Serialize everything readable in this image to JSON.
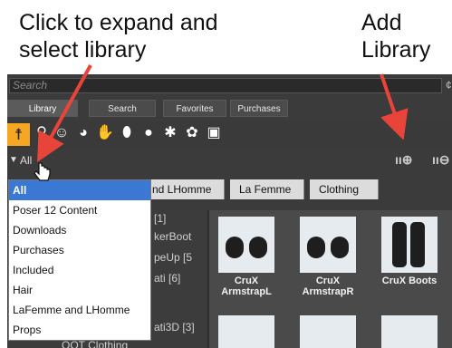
{
  "callouts": {
    "left": [
      "Click to expand and",
      "select library"
    ],
    "right": [
      "Add",
      "Library"
    ]
  },
  "search": {
    "placeholder": "Search"
  },
  "tabs": [
    {
      "label": "Library",
      "active": true
    },
    {
      "label": "Search"
    },
    {
      "label": "Favorites"
    },
    {
      "label": "Purchases"
    }
  ],
  "iconbar": {
    "icons": [
      "figure-icon",
      "pose-icon",
      "face-icon",
      "hair-icon",
      "hand-icon",
      "shoe-icon",
      "light-icon",
      "camera-icon",
      "materials-icon",
      "scene-icon"
    ]
  },
  "library_bar": {
    "selected": "All",
    "add_icon": "add-library-icon",
    "remove_icon": "remove-library-icon"
  },
  "breadcrumb": [
    "nd LHomme",
    "La Femme",
    "Clothing"
  ],
  "dropdown": {
    "items": [
      "All",
      "Poser 12 Content",
      "Downloads",
      "Purchases",
      "Included",
      "Hair",
      "LaFemme and LHomme",
      "Props"
    ],
    "selected_index": 0
  },
  "tree_fragments": [
    "[1]",
    "kerBoot",
    "peUp [5",
    "ati [6]",
    "ati3D [3]",
    "QOT Clothing"
  ],
  "thumbnails": [
    {
      "label": "CruX ArmstrapL"
    },
    {
      "label": "CruX ArmstrapR"
    },
    {
      "label": "CruX Boots"
    }
  ],
  "colors": {
    "accent_orange": "#f5a623",
    "selection_blue": "#3a78d4",
    "arrow_red": "#e8443a",
    "panel_dark": "#3b3b3b"
  }
}
